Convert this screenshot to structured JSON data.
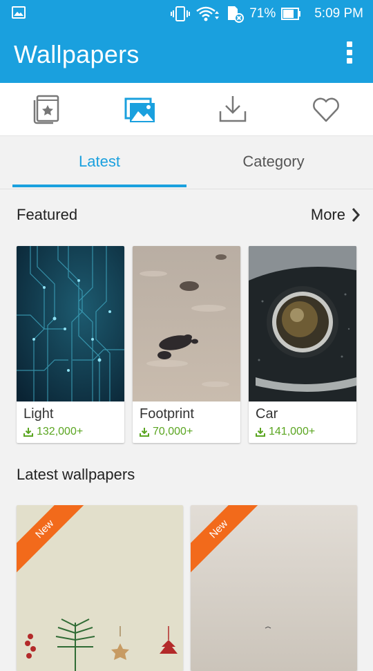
{
  "status_bar": {
    "battery_percent": "71%",
    "time": "5:09 PM"
  },
  "app_bar": {
    "title": "Wallpapers"
  },
  "icon_tabs": [
    {
      "icon": "featured-book-icon"
    },
    {
      "icon": "gallery-icon",
      "active": true
    },
    {
      "icon": "download-icon"
    },
    {
      "icon": "heart-icon"
    }
  ],
  "text_tabs": {
    "latest": "Latest",
    "category": "Category"
  },
  "featured": {
    "title": "Featured",
    "more_label": "More",
    "items": [
      {
        "name": "Light",
        "downloads": "132,000+"
      },
      {
        "name": "Footprint",
        "downloads": "70,000+"
      },
      {
        "name": "Car",
        "downloads": "141,000+"
      }
    ]
  },
  "latest": {
    "title": "Latest wallpapers",
    "items": [
      {
        "badge": "New"
      },
      {
        "badge": "New"
      }
    ]
  },
  "colors": {
    "primary": "#1aa0de",
    "download_green": "#5aa520",
    "new_badge": "#f26a1b"
  }
}
